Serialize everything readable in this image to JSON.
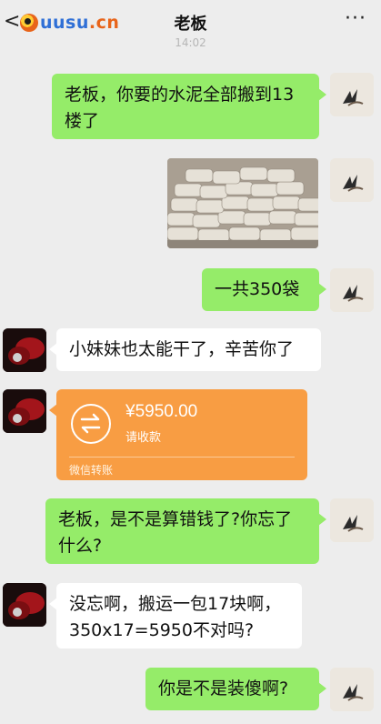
{
  "header": {
    "back_glyph": "<",
    "logo_text_main": "uusu",
    "logo_text_tld": ".cn",
    "title": "老板",
    "more_glyph": "···",
    "time": "14:02"
  },
  "messages": [
    {
      "sender": "me",
      "type": "text",
      "text": "老板，你要的水泥全部搬到13楼了"
    },
    {
      "sender": "me",
      "type": "image",
      "alt": "cement bags photo"
    },
    {
      "sender": "me",
      "type": "text",
      "text": "一共350袋"
    },
    {
      "sender": "boss",
      "type": "text",
      "text": "小妹妹也太能干了，辛苦你了"
    },
    {
      "sender": "boss",
      "type": "transfer",
      "amount": "¥5950.00",
      "status": "请收款",
      "footer": "微信转账"
    },
    {
      "sender": "me",
      "type": "text",
      "text": "老板，是不是算错钱了?你忘了什么?"
    },
    {
      "sender": "boss",
      "type": "text",
      "text": "没忘啊，搬运一包17块啊，350x17=5950不对吗?"
    },
    {
      "sender": "me",
      "type": "text",
      "text": "你是不是装傻啊?"
    }
  ],
  "colors": {
    "background": "#ededed",
    "my_bubble": "#95ec69",
    "their_bubble": "#ffffff",
    "transfer": "#f89d43"
  }
}
